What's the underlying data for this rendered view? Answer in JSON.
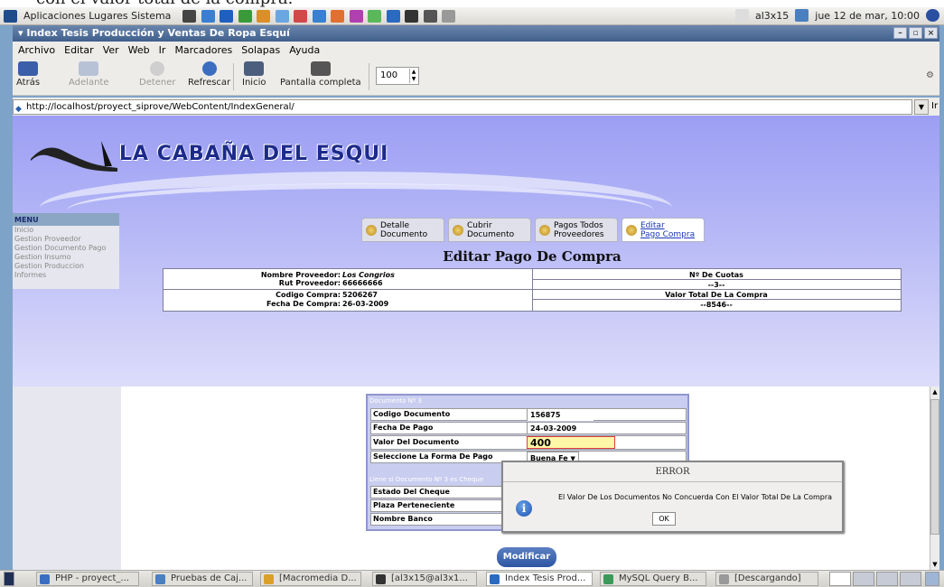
{
  "caption": "con el valor total de la compra.",
  "panel": {
    "menus": "Aplicaciones  Lugares  Sistema",
    "user": "al3x15",
    "datetime": "jue 12 de mar, 10:00"
  },
  "window": {
    "title": "Index Tesis Producción y Ventas De Ropa Esquí",
    "buttons": [
      "–",
      "▫",
      "×"
    ]
  },
  "menubar": [
    "Archivo",
    "Editar",
    "Ver",
    "Web",
    "Ir",
    "Marcadores",
    "Solapas",
    "Ayuda"
  ],
  "toolbar": {
    "back": "Atrás",
    "forward": "Adelante",
    "stop": "Detener",
    "reload": "Refrescar",
    "home": "Inicio",
    "fullscreen": "Pantalla completa",
    "zoom": "100"
  },
  "urlbar": {
    "url": "http://localhost/proyect_siprove/WebContent/IndexGeneral/",
    "go": "Ir"
  },
  "site": {
    "logo_text": "LA CABAÑA DEL ESQUI",
    "menu_title": "MENU",
    "menu_items": [
      "Inicio",
      "Gestion Proveedor",
      "Gestion Documento Pago",
      "Gestion Insumo",
      "Gestion Produccion",
      "Informes"
    ]
  },
  "tabs": [
    {
      "line1": "Detalle",
      "line2": "Documento"
    },
    {
      "line1": "Cubrir",
      "line2": "Documento"
    },
    {
      "line1": "Pagos Todos",
      "line2": "Proveedores"
    },
    {
      "line1": "Editar",
      "line2": "Pago Compra"
    }
  ],
  "page_title": "Editar Pago De Compra",
  "info": {
    "nombre_label": "Nombre Proveedor:",
    "nombre_value": "Los Congrios",
    "rut_label": "Rut Proveedor:",
    "rut_value": "66666666",
    "codigo_label": "Codigo Compra:",
    "codigo_value": "5206267",
    "fecha_label": "Fecha De Compra:",
    "fecha_value": "26-03-2009",
    "cuotas_label": "Nº De Cuotas",
    "cuotas_value": "--3--",
    "total_label": "Valor Total De La Compra",
    "total_value": "--8546--"
  },
  "document_form": {
    "legend": "Documento Nº 3",
    "rows": [
      {
        "label": "Codigo Documento",
        "value": "156875"
      },
      {
        "label": "Fecha De Pago",
        "value": "24-03-2009"
      },
      {
        "label": "Valor Del Documento",
        "value": "400"
      },
      {
        "label": "Seleccione La Forma De Pago",
        "value": "Buena Fe"
      }
    ],
    "cheque_legend": "Llene si Documento Nº 3 es Cheque",
    "cheque_rows": [
      "Estado Del Cheque",
      "Plaza Perteneciente",
      "Nombre Banco"
    ]
  },
  "dialog": {
    "title": "ERROR",
    "message": "El Valor De Los Documentos No Concuerda Con El Valor Total De La Compra",
    "ok": "OK"
  },
  "modify_button": "Modificar",
  "taskbar": [
    "PHP - proyect_...",
    "Pruebas de Caj...",
    "[Macromedia D...",
    "[al3x15@al3x1...",
    "Index Tesis Prod...",
    "MySQL Query B...",
    "[Descargando]"
  ]
}
